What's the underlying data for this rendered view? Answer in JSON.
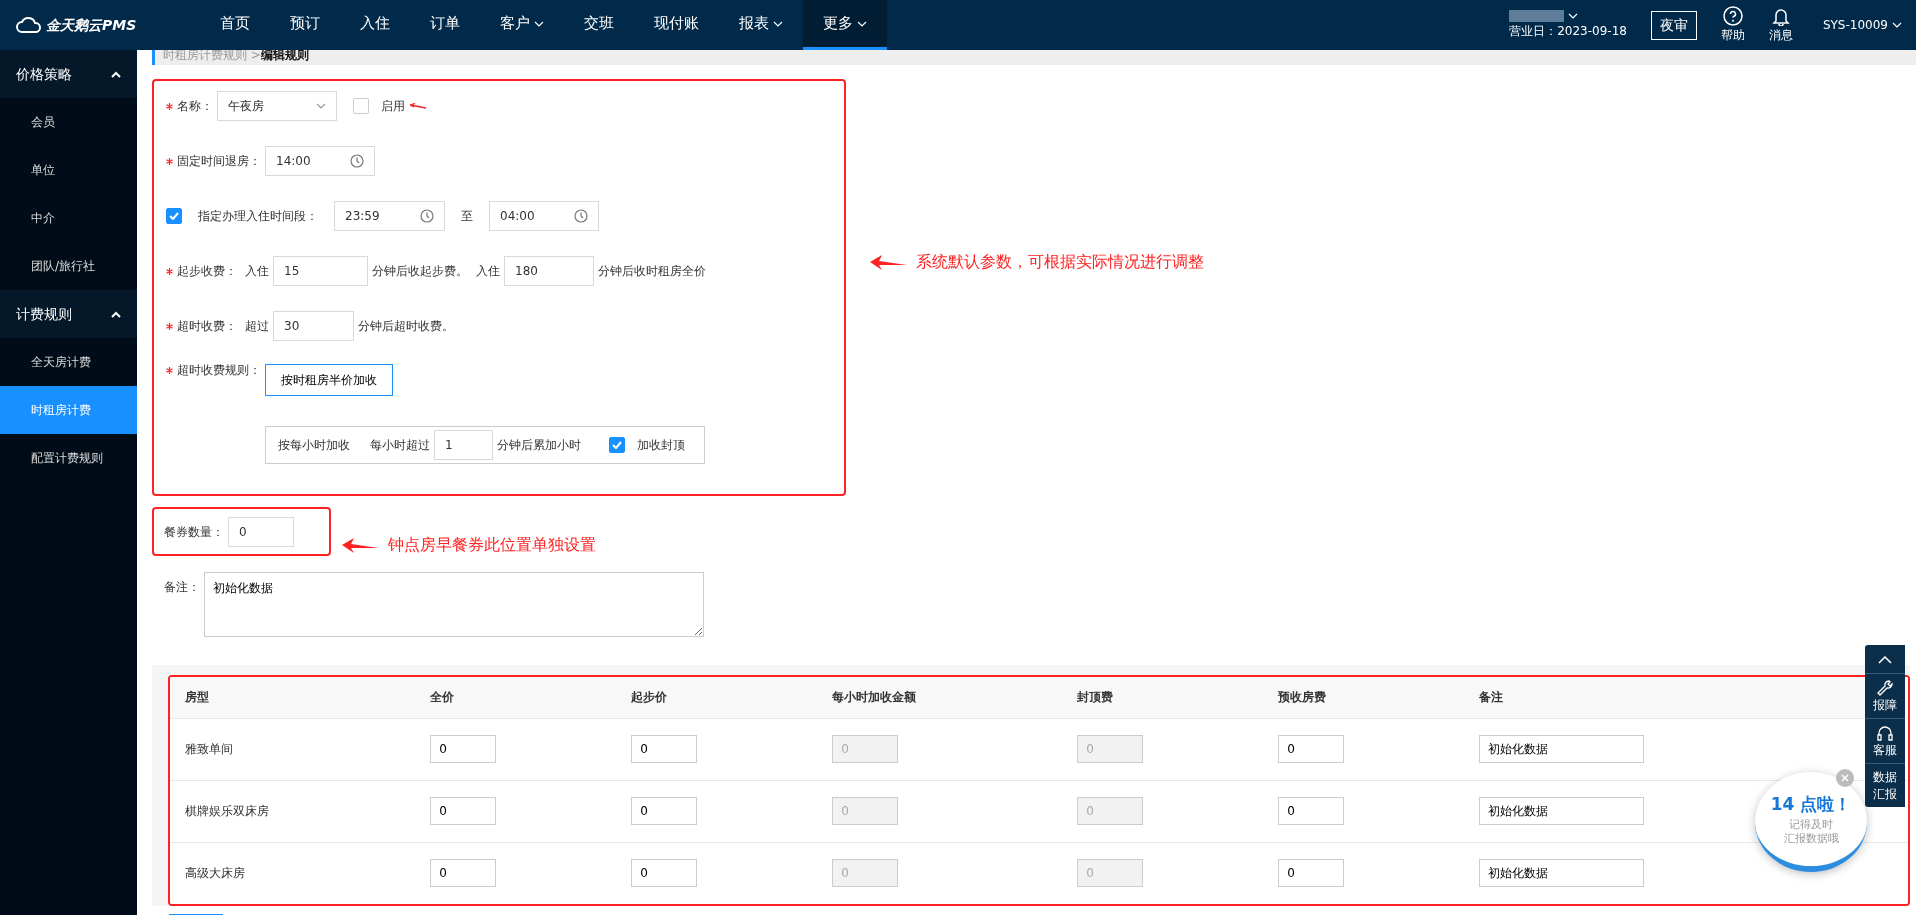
{
  "nav": {
    "logo": "金天鹅云PMS",
    "items": [
      {
        "label": "首页",
        "dropdown": false,
        "selected": false
      },
      {
        "label": "预订",
        "dropdown": false,
        "selected": false
      },
      {
        "label": "入住",
        "dropdown": false,
        "selected": false
      },
      {
        "label": "订单",
        "dropdown": false,
        "selected": false
      },
      {
        "label": "客户",
        "dropdown": true,
        "selected": false
      },
      {
        "label": "交班",
        "dropdown": false,
        "selected": false
      },
      {
        "label": "现付账",
        "dropdown": false,
        "selected": false
      },
      {
        "label": "报表",
        "dropdown": true,
        "selected": false
      },
      {
        "label": "更多",
        "dropdown": true,
        "selected": true
      }
    ],
    "business_date": "营业日：2023-09-18",
    "night_audit": "夜审",
    "help": "帮助",
    "messages": "消息",
    "user": "SYS-10009"
  },
  "sidebar": {
    "groups": [
      {
        "title": "价格策略",
        "expanded": true,
        "items": [
          {
            "label": "会员",
            "selected": false
          },
          {
            "label": "单位",
            "selected": false
          },
          {
            "label": "中介",
            "selected": false
          },
          {
            "label": "团队/旅行社",
            "selected": false
          }
        ]
      },
      {
        "title": "计费规则",
        "expanded": true,
        "items": [
          {
            "label": "全天房计费",
            "selected": false
          },
          {
            "label": "时租房计费",
            "selected": true
          },
          {
            "label": "配置计费规则",
            "selected": false
          }
        ]
      }
    ]
  },
  "breadcrumb": {
    "parent": "时租房计费规则",
    "separator": ">",
    "current": "编辑规则"
  },
  "form": {
    "name": {
      "label": "名称：",
      "required": true,
      "value": "午夜房"
    },
    "enabled": {
      "label": "启用",
      "checked": false
    },
    "fixed_checkout": {
      "label": "固定时间退房：",
      "required": true,
      "value": "14:00"
    },
    "checkin_window": {
      "label": "指定办理入住时间段：",
      "checked": true,
      "from": "23:59",
      "to_label": "至",
      "to": "04:00"
    },
    "start_fee": {
      "label": "起步收费：",
      "required": true,
      "prefix": "入住",
      "value": "15",
      "suffix": "分钟后收起步费。",
      "prefix2": "入住",
      "value2": "180",
      "suffix2": "分钟后收时租房全价"
    },
    "overtime_fee": {
      "label": "超时收费：",
      "required": true,
      "prefix": "超过",
      "value": "30",
      "suffix": "分钟后超时收费。"
    },
    "overtime_rule": {
      "label": "超时收费规则：",
      "required": true,
      "options": [
        {
          "kind": "button",
          "label": "按时租房半价加收",
          "selected": true
        },
        {
          "kind": "hourly",
          "label": "按每小时加收",
          "selected": false,
          "prefix": "每小时超过",
          "value": "1",
          "suffix": "分钟后累加小时",
          "cap_label": "加收封顶",
          "cap_checked": true
        }
      ]
    },
    "meal_vouchers": {
      "label": "餐券数量：",
      "value": "0"
    },
    "remark": {
      "label": "备注：",
      "value": "初始化数据"
    }
  },
  "table": {
    "columns": [
      "房型",
      "全价",
      "起步价",
      "每小时加收金额",
      "封顶费",
      "预收房费",
      "备注"
    ],
    "rows": [
      {
        "cells": [
          {
            "value": "雅致单间",
            "disabled": false
          },
          {
            "value": "0",
            "disabled": false
          },
          {
            "value": "0",
            "disabled": false
          },
          {
            "value": "0",
            "disabled": true
          },
          {
            "value": "0",
            "disabled": true
          },
          {
            "value": "0",
            "disabled": false
          },
          {
            "value": "初始化数据",
            "disabled": false
          }
        ]
      },
      {
        "cells": [
          {
            "value": "棋牌娱乐双床房",
            "disabled": false
          },
          {
            "value": "0",
            "disabled": false
          },
          {
            "value": "0",
            "disabled": false
          },
          {
            "value": "0",
            "disabled": true
          },
          {
            "value": "0",
            "disabled": true
          },
          {
            "value": "0",
            "disabled": false
          },
          {
            "value": "初始化数据",
            "disabled": false
          }
        ]
      },
      {
        "cells": [
          {
            "value": "高级大床房",
            "disabled": false
          },
          {
            "value": "0",
            "disabled": false
          },
          {
            "value": "0",
            "disabled": false
          },
          {
            "value": "0",
            "disabled": true
          },
          {
            "value": "0",
            "disabled": true
          },
          {
            "value": "0",
            "disabled": false
          },
          {
            "value": "初始化数据",
            "disabled": false
          }
        ]
      }
    ]
  },
  "annotations": [
    {
      "text": "系统默认参数，可根据实际情况进行调整"
    },
    {
      "text": "钟点房早餐券此位置单独设置"
    }
  ],
  "side_tools": [
    {
      "kind": "wrench",
      "label": "报障"
    },
    {
      "kind": "headset",
      "label": "客服"
    },
    {
      "kind": "text",
      "label": "数据汇报"
    }
  ],
  "reminder": {
    "title": "14 点啦！",
    "lines": [
      "记得及时",
      "汇报数据哦"
    ]
  }
}
